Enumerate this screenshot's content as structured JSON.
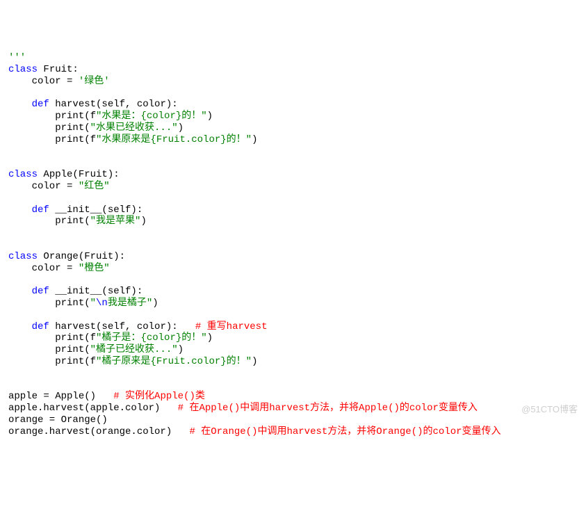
{
  "code": {
    "line01_trail": "'''",
    "fruit_class_kw": "class",
    "fruit_class_name": " Fruit:",
    "fruit_color_lhs": "    color = ",
    "fruit_color_rhs": "'绿色'",
    "fruit_def_kw": "    def",
    "fruit_def_name": " harvest(self, color):",
    "fruit_p1_a": "        print(f",
    "fruit_p1_b": "\"水果是：{color}的！\"",
    "fruit_p1_c": ")",
    "fruit_p2_a": "        print(",
    "fruit_p2_b": "\"水果已经收获...\"",
    "fruit_p2_c": ")",
    "fruit_p3_a": "        print(f",
    "fruit_p3_b": "\"水果原来是{Fruit.color}的！\"",
    "fruit_p3_c": ")",
    "apple_class_kw": "class",
    "apple_class_name": " Apple(Fruit):",
    "apple_color_lhs": "    color = ",
    "apple_color_rhs": "\"红色\"",
    "apple_init_kw": "    def",
    "apple_init_name": " __init__(self):",
    "apple_p1_a": "        print(",
    "apple_p1_b": "\"我是苹果\"",
    "apple_p1_c": ")",
    "orange_class_kw": "class",
    "orange_class_name": " Orange(Fruit):",
    "orange_color_lhs": "    color = ",
    "orange_color_rhs": "\"橙色\"",
    "orange_init_kw": "    def",
    "orange_init_name": " __init__(self):",
    "orange_p1_a": "        print(",
    "orange_p1_b1": "\"",
    "orange_p1_esc": "\\n",
    "orange_p1_b2": "我是橘子\"",
    "orange_p1_c": ")",
    "orange_harv_kw": "    def",
    "orange_harv_name": " harvest(self, color):   ",
    "orange_harv_cmt": "# 重写harvest",
    "orange_hp1_a": "        print(f",
    "orange_hp1_b": "\"橘子是：{color}的！\"",
    "orange_hp1_c": ")",
    "orange_hp2_a": "        print(",
    "orange_hp2_b": "\"橘子已经收获...\"",
    "orange_hp2_c": ")",
    "orange_hp3_a": "        print(f",
    "orange_hp3_b": "\"橘子原来是{Fruit.color}的！\"",
    "orange_hp3_c": ")",
    "inst1_a": "apple = Apple()   ",
    "inst1_cmt": "# 实例化Apple()类",
    "inst2_a": "apple.harvest(apple.color)   ",
    "inst2_cmt": "# 在Apple()中调用harvest方法，并将Apple()的color变量传入",
    "inst3": "orange = Orange()",
    "inst4_a": "orange.harvest(orange.color)   ",
    "inst4_cmt": "# 在Orange()中调用harvest方法，并将Orange()的color变量传入"
  },
  "watermark": "@51CTO博客"
}
